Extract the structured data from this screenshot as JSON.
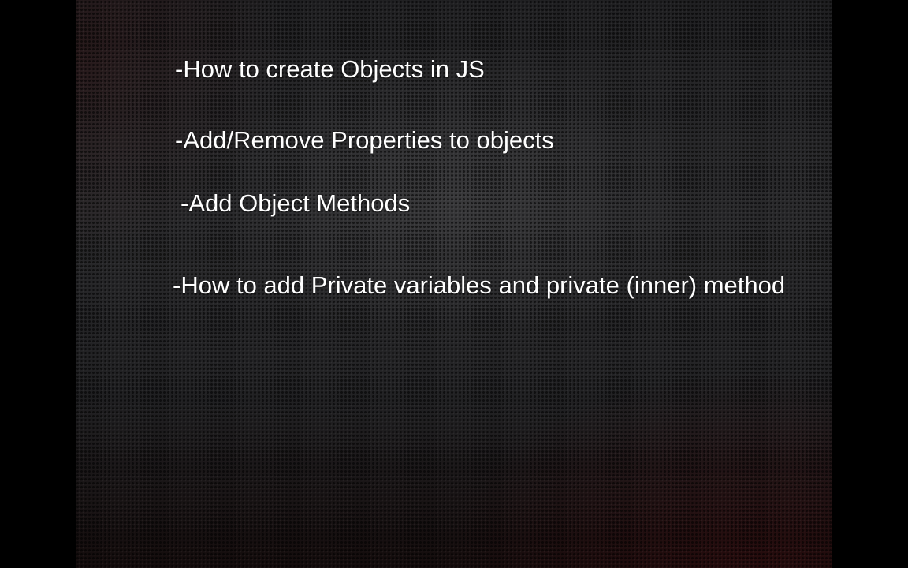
{
  "slide": {
    "bullets": [
      "-How to create Objects in JS",
      "-Add/Remove Properties to objects",
      " -Add Object Methods",
      "-How to add Private variables and private (inner) method"
    ]
  }
}
